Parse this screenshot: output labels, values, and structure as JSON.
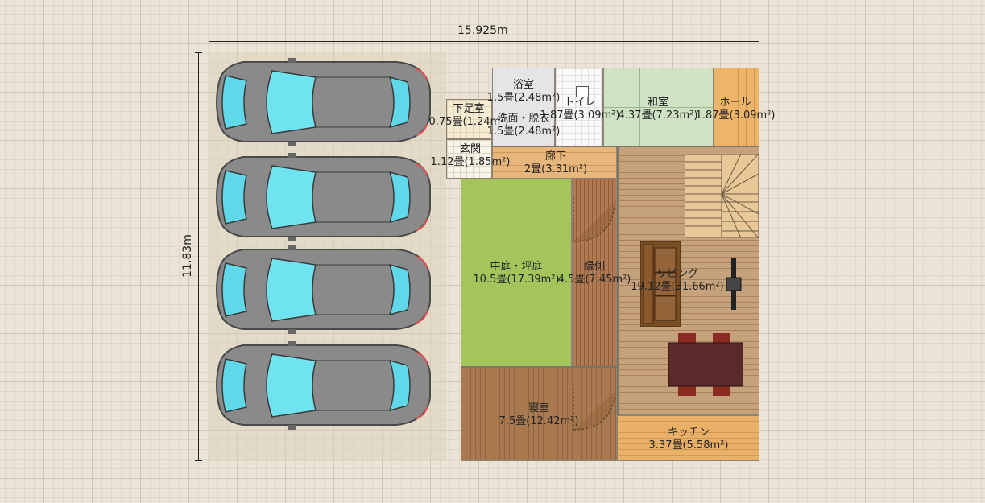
{
  "dimensions": {
    "width_label": "15.925m",
    "height_label": "11.83m"
  },
  "parking": {
    "car_count": 4,
    "body_color": "#8a8a8a",
    "glass_color": "#5fd8ea"
  },
  "rooms": {
    "bath": {
      "name": "浴室",
      "area": "1.5畳(2.48m²)"
    },
    "toilet": {
      "name": "トイレ",
      "area": "1.87畳(3.09m²)"
    },
    "washroom": {
      "name": "洗面・脱衣",
      "area": "1.5畳(2.48m²)"
    },
    "washitsu": {
      "name": "和室",
      "area": "4.37畳(7.23m²)"
    },
    "hall": {
      "name": "ホール",
      "area": "1.87畳(3.09m²)"
    },
    "shoe": {
      "name": "下足室",
      "area": "0.75畳(1.24m²)"
    },
    "genkan": {
      "name": "玄関",
      "area": "1.12畳(1.85m²)"
    },
    "corridor": {
      "name": "廊下",
      "area": "2畳(3.31m²)"
    },
    "courtyard": {
      "name": "中庭・坪庭",
      "area": "10.5畳(17.39m²)"
    },
    "engawa": {
      "name": "縁側",
      "area": "4.5畳(7.45m²)"
    },
    "living": {
      "name": "リビング",
      "area": "19.12畳(31.66m²)"
    },
    "bedroom": {
      "name": "寝室",
      "area": "7.5畳(12.42m²)"
    },
    "kitchen": {
      "name": "キッチン",
      "area": "3.37畳(5.58m²)"
    }
  },
  "colors": {
    "courtyard": "#a3c55c",
    "washitsu": "#cfe3c4",
    "wood_floor": "#c6a27c",
    "sofa": "#7a4e24",
    "dining_table": "#5a2a2a"
  }
}
